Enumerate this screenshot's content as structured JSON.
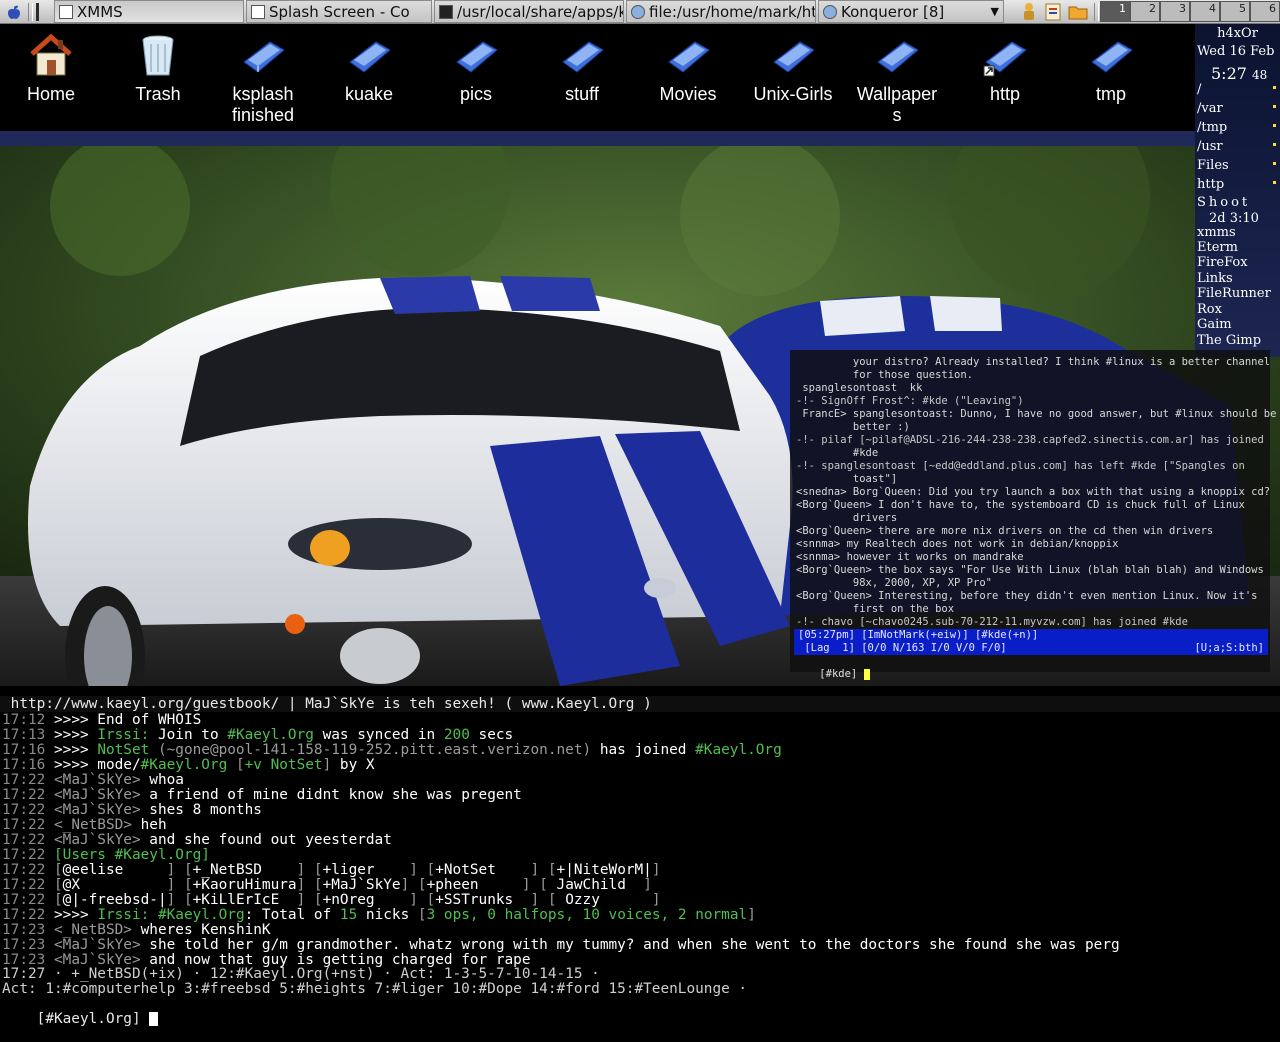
{
  "taskbar": {
    "items": [
      "XMMS",
      "Splash Screen - Co",
      "/usr/local/share/apps/k",
      "file:/usr/home/mark/htt",
      "Konqueror [8]"
    ],
    "desktops": [
      "1",
      "2",
      "3",
      "4",
      "5",
      "6"
    ]
  },
  "desktop_icons": [
    {
      "label": "Home"
    },
    {
      "label": "Trash"
    },
    {
      "label": "ksplash finished"
    },
    {
      "label": "kuake"
    },
    {
      "label": "pics"
    },
    {
      "label": "stuff"
    },
    {
      "label": "Movies"
    },
    {
      "label": "Unix-Girls"
    },
    {
      "label": "Wallpapers"
    },
    {
      "label": "http"
    },
    {
      "label": "tmp"
    }
  ],
  "sidebar": {
    "host": "h4xOr",
    "date": "Wed 16 Feb",
    "time": "5:27",
    "seconds": "48",
    "mounts": [
      "/",
      "/var",
      "/tmp",
      "/usr",
      "Files",
      "http"
    ],
    "shoot_label": "Shoot",
    "shoot_time": "2d 3:10",
    "apps": [
      "xmms",
      "Eterm",
      "FireFox",
      "Links",
      "FileRunner",
      "Rox",
      "Gaim",
      "The Gimp"
    ]
  },
  "small_irc": {
    "lines": [
      "         your distro? Already installed? I think #linux is a better channel",
      "         for those question.",
      " spanglesontoast  kk",
      "-!- SignOff Frost^: #kde (\"Leaving\")",
      " FrancE> spanglesontoast: Dunno, I have no good answer, but #linux should be",
      "         better :)",
      "-!- pilaf [~pilaf@ADSL-216-244-238-238.capfed2.sinectis.com.ar] has joined",
      "         #kde",
      "-!- spanglesontoast [~edd@eddland.plus.com] has left #kde [\"Spangles on",
      "         toast\"]",
      "<snedna> Borg`Queen: Did you try launch a box with that using a knoppix cd?",
      "<Borg`Queen> I don't have to, the systemboard CD is chuck full of Linux",
      "         drivers",
      "<Borg`Queen> there are more nix drivers on the cd then win drivers",
      "<snnma> my Realtech does not work in debian/knoppix",
      "<snnma> however it works on mandrake",
      "<Borg`Queen> the box says \"For Use With Linux (blah blah blah) and Windows",
      "         98x, 2000, XP, XP Pro\"",
      "<Borg`Queen> Interesting, before they didn't even mention Linux. Now it's",
      "         first on the box",
      "-!- chavo [~chavo0245.sub-70-212-11.myvzw.com] has joined #kde"
    ],
    "status1": "[05:27pm] [ImNotMark(+eiw)] [#kde(+n)]",
    "status2": " [Lag  1] [0/0 N/163 I/0 V/0 F/0]",
    "status2_right": "[U;a;S:bth]",
    "prompt": "[#kde] "
  },
  "big_irc": {
    "topic": " http://www.kaeyl.org/guestbook/ | MaJ`SkYe is teh sexeh! ( www.Kaeyl.Org )",
    "lines": [
      {
        "ts": "17:12",
        "parts": [
          [
            " >>>> End of WHOIS",
            "wht"
          ]
        ]
      },
      {
        "ts": "17:13",
        "parts": [
          [
            " >>>> ",
            "wht"
          ],
          [
            "Irssi:",
            "grn"
          ],
          [
            " Join to ",
            "wht"
          ],
          [
            "#Kaeyl.Org",
            "grn"
          ],
          [
            " was synced in ",
            "wht"
          ],
          [
            "200",
            "grn"
          ],
          [
            " secs",
            "wht"
          ]
        ]
      },
      {
        "ts": "17:16",
        "parts": [
          [
            " >>>> ",
            "wht"
          ],
          [
            "NotSet",
            "grn"
          ],
          [
            " (~gone@pool-141-158-119-252.pitt.east.verizon.net)",
            "gry"
          ],
          [
            " has joined ",
            "wht"
          ],
          [
            "#Kaeyl.Org",
            "grn"
          ]
        ]
      },
      {
        "ts": "17:16",
        "parts": [
          [
            " >>>> mode/",
            "wht"
          ],
          [
            "#Kaeyl.Org",
            "grn"
          ],
          [
            " [",
            "gry"
          ],
          [
            "+v NotSet",
            "grn"
          ],
          [
            "]",
            "gry"
          ],
          [
            " by X",
            "wht"
          ]
        ]
      },
      {
        "ts": "17:22",
        "parts": [
          [
            " <MaJ`SkYe> ",
            "gry"
          ],
          [
            "whoa",
            "wht"
          ]
        ]
      },
      {
        "ts": "17:22",
        "parts": [
          [
            " <MaJ`SkYe> ",
            "gry"
          ],
          [
            "a friend of mine didnt know she was pregent",
            "wht"
          ]
        ]
      },
      {
        "ts": "17:22",
        "parts": [
          [
            " <MaJ`SkYe> ",
            "gry"
          ],
          [
            "shes 8 months",
            "wht"
          ]
        ]
      },
      {
        "ts": "17:22",
        "parts": [
          [
            " <_NetBSD> ",
            "gry"
          ],
          [
            "heh",
            "wht"
          ]
        ]
      },
      {
        "ts": "17:22",
        "parts": [
          [
            " <MaJ`SkYe> ",
            "gry"
          ],
          [
            "and she found out yeesterdat",
            "wht"
          ]
        ]
      },
      {
        "ts": "17:22",
        "parts": [
          [
            " [Users ",
            "grn"
          ],
          [
            "#Kaeyl.Org",
            "grn"
          ],
          [
            "]",
            "grn"
          ]
        ]
      },
      {
        "ts": "17:22",
        "parts": [
          [
            " [",
            "gry"
          ],
          [
            "@eelise     ",
            "wht"
          ],
          [
            "] [",
            "gry"
          ],
          [
            "+_NetBSD    ",
            "wht"
          ],
          [
            "] [",
            "gry"
          ],
          [
            "+liger    ",
            "wht"
          ],
          [
            "] [",
            "gry"
          ],
          [
            "+NotSet    ",
            "wht"
          ],
          [
            "] [",
            "gry"
          ],
          [
            "+|NiteWorM|",
            "wht"
          ],
          [
            "]",
            "gry"
          ]
        ]
      },
      {
        "ts": "17:22",
        "parts": [
          [
            " [",
            "gry"
          ],
          [
            "@X          ",
            "wht"
          ],
          [
            "] [",
            "gry"
          ],
          [
            "+KaoruHimura",
            "wht"
          ],
          [
            "] [",
            "gry"
          ],
          [
            "+MaJ`SkYe",
            "wht"
          ],
          [
            "] [",
            "gry"
          ],
          [
            "+pheen     ",
            "wht"
          ],
          [
            "] [",
            "gry"
          ],
          [
            " JawChild  ",
            "wht"
          ],
          [
            "]",
            "gry"
          ]
        ]
      },
      {
        "ts": "17:22",
        "parts": [
          [
            " [",
            "gry"
          ],
          [
            "@|-freebsd-|",
            "wht"
          ],
          [
            "] [",
            "gry"
          ],
          [
            "+KiLlErIcE  ",
            "wht"
          ],
          [
            "] [",
            "gry"
          ],
          [
            "+nOreg    ",
            "wht"
          ],
          [
            "] [",
            "gry"
          ],
          [
            "+SSTrunks  ",
            "wht"
          ],
          [
            "] [",
            "gry"
          ],
          [
            " Ozzy      ",
            "wht"
          ],
          [
            "]",
            "gry"
          ]
        ]
      },
      {
        "ts": "17:22",
        "parts": [
          [
            " >>>> ",
            "wht"
          ],
          [
            "Irssi:",
            "grn"
          ],
          [
            " ",
            "wht"
          ],
          [
            "#Kaeyl.Org",
            "grn"
          ],
          [
            ": Total of ",
            "wht"
          ],
          [
            "15",
            "grn"
          ],
          [
            " nicks ",
            "wht"
          ],
          [
            "[",
            "gry"
          ],
          [
            "3",
            "grn"
          ],
          [
            " ops, ",
            "grn"
          ],
          [
            "0",
            "grn"
          ],
          [
            " halfops, ",
            "grn"
          ],
          [
            "10",
            "grn"
          ],
          [
            " voices, ",
            "grn"
          ],
          [
            "2",
            "grn"
          ],
          [
            " normal",
            "grn"
          ],
          [
            "]",
            "gry"
          ]
        ]
      },
      {
        "ts": "17:23",
        "parts": [
          [
            " <_NetBSD> ",
            "gry"
          ],
          [
            "wheres KenshinK",
            "wht"
          ]
        ]
      },
      {
        "ts": "17:23",
        "parts": [
          [
            " <MaJ`SkYe> ",
            "gry"
          ],
          [
            "she told her g/m grandmother. whatz wrong with my tummy? and when she went to the doctors she found she was perg",
            "wht"
          ]
        ]
      },
      {
        "ts": "17:23",
        "parts": [
          [
            " <MaJ`SkYe> ",
            "gry"
          ],
          [
            "and now that guy is getting charged for rape",
            "wht"
          ]
        ]
      }
    ],
    "status1": "17:27 · +_NetBSD(+ix) · 12:#Kaeyl.Org(+nst) · Act: 1-3-5-7-10-14-15 ·",
    "status2": "Act: 1:#computerhelp 3:#freebsd 5:#heights 7:#liger 10:#Dope 14:#ford 15:#TeenLounge ·",
    "prompt": "[#Kaeyl.Org] "
  },
  "colors": {
    "desktop_bar": "#202a5a",
    "irc_status_bar": "#0a1ec8",
    "irc_green": "#4fbf4f"
  }
}
